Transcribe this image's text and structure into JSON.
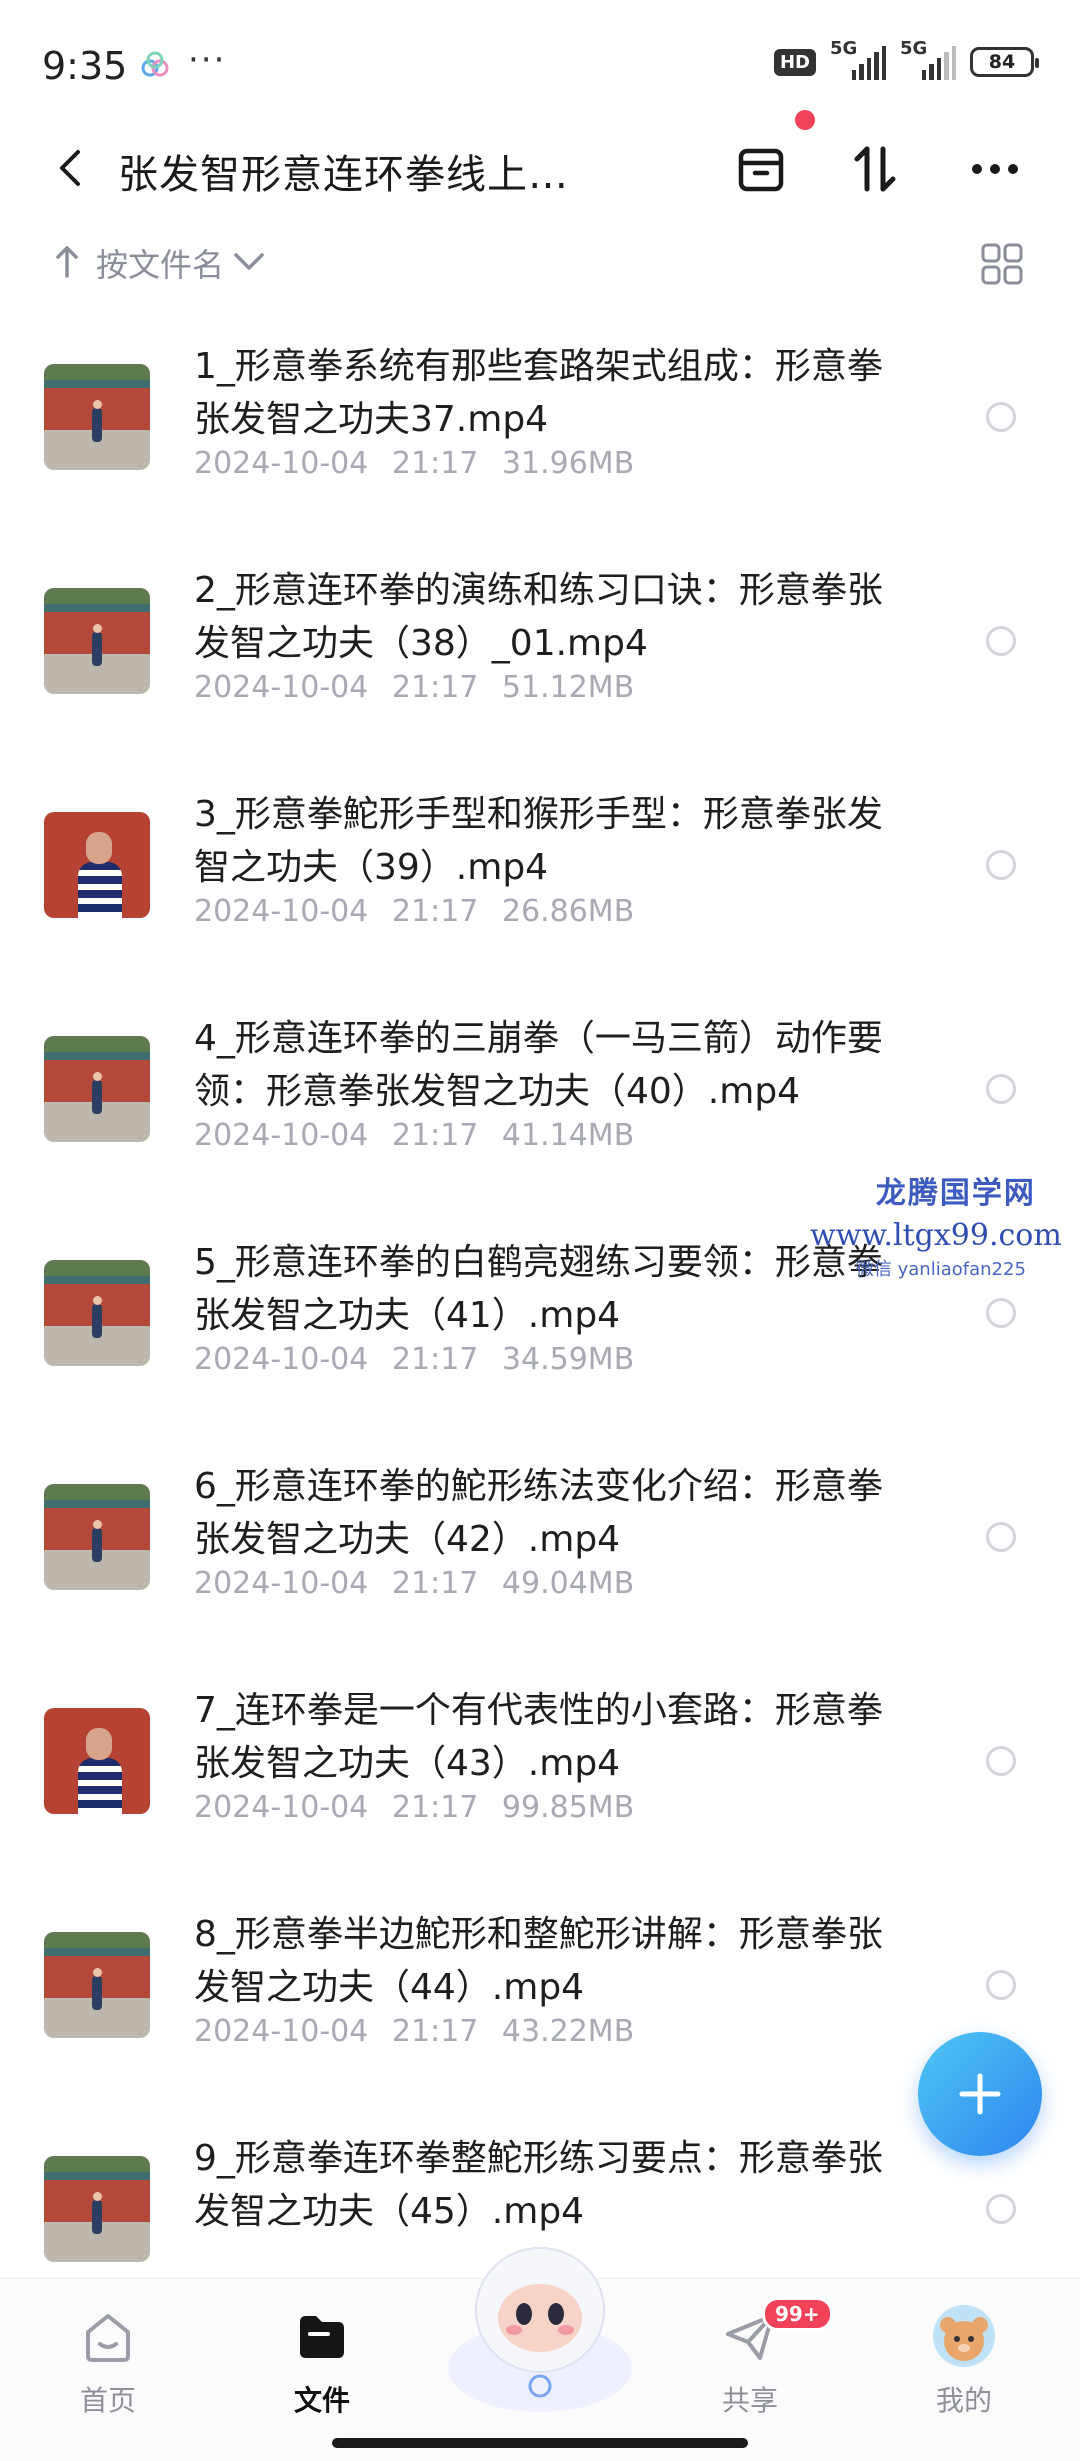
{
  "status_bar": {
    "time": "9:35",
    "dots": "···",
    "hd": "HD",
    "net1": "5G",
    "net2": "5G",
    "battery": "84"
  },
  "header": {
    "title": "张发智形意连环拳线上…"
  },
  "sort": {
    "label": "按文件名"
  },
  "files": [
    {
      "name": "1_形意拳系统有那些套路架式组成：形意拳张发智之功夫37.mp4",
      "date": "2024-10-04",
      "time": "21:17",
      "size": "31.96MB",
      "thumb": "wide"
    },
    {
      "name": "2_形意连环拳的演练和练习口诀：形意拳张发智之功夫（38）_01.mp4",
      "date": "2024-10-04",
      "time": "21:17",
      "size": "51.12MB",
      "thumb": "wide"
    },
    {
      "name": "3_形意拳鮀形手型和猴形手型：形意拳张发智之功夫（39）.mp4",
      "date": "2024-10-04",
      "time": "21:17",
      "size": "26.86MB",
      "thumb": "close"
    },
    {
      "name": "4_形意连环拳的三崩拳（一马三箭）动作要领：形意拳张发智之功夫（40）.mp4",
      "date": "2024-10-04",
      "time": "21:17",
      "size": "41.14MB",
      "thumb": "wide"
    },
    {
      "name": "5_形意连环拳的白鹤亮翅练习要领：形意拳张发智之功夫（41）.mp4",
      "date": "2024-10-04",
      "time": "21:17",
      "size": "34.59MB",
      "thumb": "wide"
    },
    {
      "name": "6_形意连环拳的鮀形练法变化介绍：形意拳张发智之功夫（42）.mp4",
      "date": "2024-10-04",
      "time": "21:17",
      "size": "49.04MB",
      "thumb": "wide"
    },
    {
      "name": "7_连环拳是一个有代表性的小套路：形意拳张发智之功夫（43）.mp4",
      "date": "2024-10-04",
      "time": "21:17",
      "size": "99.85MB",
      "thumb": "close"
    },
    {
      "name": "8_形意拳半边鮀形和整鮀形讲解：形意拳张发智之功夫（44）.mp4",
      "date": "2024-10-04",
      "time": "21:17",
      "size": "43.22MB",
      "thumb": "wide"
    },
    {
      "name": "9_形意拳连环拳整鮀形练习要点：形意拳张发智之功夫（45）.mp4",
      "date": "",
      "time": "",
      "size": "",
      "thumb": "wide"
    }
  ],
  "watermark": {
    "line1": "龙腾国学网",
    "line2": "www.ltgx99.com",
    "line3": "微信 yanliaofan225"
  },
  "nav": {
    "items": [
      {
        "label": "首页",
        "icon": "home-icon",
        "active": false
      },
      {
        "label": "文件",
        "icon": "folder-icon",
        "active": true
      },
      {
        "label": "共享",
        "icon": "paper-plane-icon",
        "active": false,
        "badge": "99+"
      },
      {
        "label": "我的",
        "icon": "avatar",
        "active": false
      }
    ]
  },
  "colors": {
    "accent": "#2f86ee",
    "badge": "#f2425a",
    "muted": "#a7aab2"
  }
}
